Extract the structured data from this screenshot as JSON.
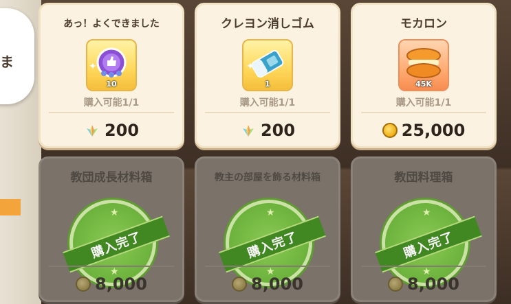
{
  "side_bubble": {
    "text": "ま"
  },
  "cards": [
    {
      "title": "あっ！よくできました",
      "icon": "good-job-medal-icon",
      "icon_qty": "10",
      "limit": "購入可能1/1",
      "currency_icon": "leaf-crystal-icon",
      "price": "200",
      "sold": false
    },
    {
      "title": "クレヨン消しゴム",
      "icon": "crayon-eraser-icon",
      "icon_qty": "1",
      "limit": "購入可能1/1",
      "currency_icon": "leaf-crystal-icon",
      "price": "200",
      "sold": false
    },
    {
      "title": "モカロン",
      "icon": "mocaron-icon",
      "icon_qty": "45K",
      "limit": "購入可能1/1",
      "currency_icon": "gold-coin-icon",
      "price": "25,000",
      "sold": false
    },
    {
      "title": "教団成長材料箱",
      "limit": "",
      "currency_icon": "gold-coin-icon",
      "price": "8,000",
      "sold": true,
      "stamp": "購入完了"
    },
    {
      "title": "教主の部屋を飾る材料箱",
      "limit": "",
      "currency_icon": "gold-coin-icon",
      "price": "8,000",
      "sold": true,
      "stamp": "購入完了"
    },
    {
      "title": "教団料理箱",
      "limit": "",
      "currency_icon": "gold-coin-icon",
      "price": "8,000",
      "sold": true,
      "stamp": "購入完了"
    }
  ],
  "colors": {
    "card_bg": "#fbf2e1",
    "sold_bg": "#7b736a",
    "stamp_green": "#6cb63a",
    "icon_yellow": "#ffd75a",
    "icon_orange": "#ffab73"
  }
}
